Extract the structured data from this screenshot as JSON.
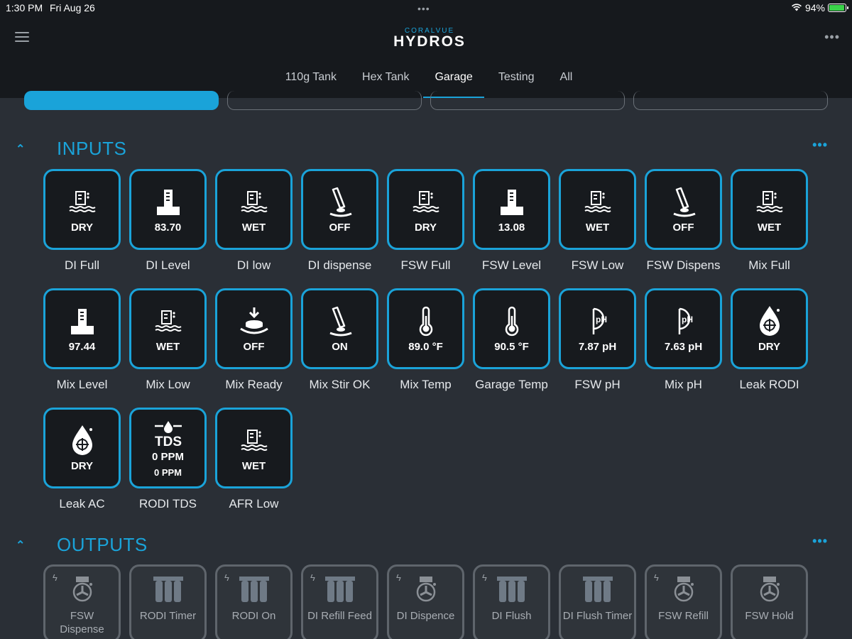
{
  "status_bar": {
    "time": "1:30 PM",
    "date": "Fri Aug 26",
    "battery": "94%",
    "battery_level": 0.94
  },
  "logo": {
    "small": "CORALVUE",
    "big": "HYDROS"
  },
  "tabs": [
    {
      "label": "110g Tank"
    },
    {
      "label": "Hex Tank"
    },
    {
      "label": "Garage",
      "active": true
    },
    {
      "label": "Testing"
    },
    {
      "label": "All"
    }
  ],
  "inputs": {
    "title": "INPUTS",
    "tiles": [
      {
        "label": "DI Full",
        "value": "DRY",
        "icon": "float-switch-icon"
      },
      {
        "label": "DI Level",
        "value": "83.70",
        "icon": "level-sensor-icon"
      },
      {
        "label": "DI low",
        "value": "WET",
        "icon": "float-switch-icon"
      },
      {
        "label": "DI dispense",
        "value": "OFF",
        "icon": "lever-switch-icon"
      },
      {
        "label": "FSW Full",
        "value": "DRY",
        "icon": "float-switch-icon"
      },
      {
        "label": "FSW Level",
        "value": "13.08",
        "icon": "level-sensor-icon"
      },
      {
        "label": "FSW Low",
        "value": "WET",
        "icon": "float-switch-icon"
      },
      {
        "label": "FSW Dispens",
        "value": "OFF",
        "icon": "lever-switch-icon"
      },
      {
        "label": "Mix Full",
        "value": "WET",
        "icon": "float-switch-icon"
      },
      {
        "label": "Mix Level",
        "value": "97.44",
        "icon": "level-sensor-icon"
      },
      {
        "label": "Mix Low",
        "value": "WET",
        "icon": "float-switch-icon"
      },
      {
        "label": "Mix Ready",
        "value": "OFF",
        "icon": "push-button-icon"
      },
      {
        "label": "Mix Stir OK",
        "value": "ON",
        "icon": "lever-switch-icon"
      },
      {
        "label": "Mix Temp",
        "value": "89.0 °F",
        "icon": "thermometer-icon"
      },
      {
        "label": "Garage Temp",
        "value": "90.5 °F",
        "icon": "thermometer-icon"
      },
      {
        "label": "FSW pH",
        "value": "7.87 pH",
        "icon": "ph-probe-icon"
      },
      {
        "label": "Mix pH",
        "value": "7.63 pH",
        "icon": "ph-probe-icon"
      },
      {
        "label": "Leak RODI",
        "value": "DRY",
        "icon": "leak-sensor-icon"
      },
      {
        "label": "Leak AC",
        "value": "DRY",
        "icon": "leak-sensor-icon"
      },
      {
        "label": "RODI TDS",
        "value": "0 PPM",
        "value2": "0 PPM",
        "icon": "tds-icon"
      },
      {
        "label": "AFR Low",
        "value": "WET",
        "icon": "float-switch-icon"
      }
    ]
  },
  "outputs": {
    "title": "OUTPUTS",
    "tiles": [
      {
        "label": "FSW Dispense",
        "icon": "pump-icon",
        "bolt": true
      },
      {
        "label": "RODI Timer",
        "icon": "filter-icon",
        "bolt": false
      },
      {
        "label": "RODI On",
        "icon": "filter-icon",
        "bolt": true
      },
      {
        "label": "DI Refill Feed",
        "icon": "filter-icon",
        "bolt": true
      },
      {
        "label": "DI Dispence",
        "icon": "pump-icon",
        "bolt": true
      },
      {
        "label": "DI Flush",
        "icon": "filter-icon",
        "bolt": true
      },
      {
        "label": "DI Flush Timer",
        "icon": "filter-icon",
        "bolt": false
      },
      {
        "label": "FSW Refill",
        "icon": "pump-icon",
        "bolt": true
      },
      {
        "label": "FSW Hold",
        "icon": "pump-icon",
        "bolt": false
      }
    ]
  },
  "colors": {
    "accent": "#1aa3d9",
    "tile_bg": "#171a1e",
    "page_bg": "#2a2f36",
    "header_bg": "#16191d"
  }
}
